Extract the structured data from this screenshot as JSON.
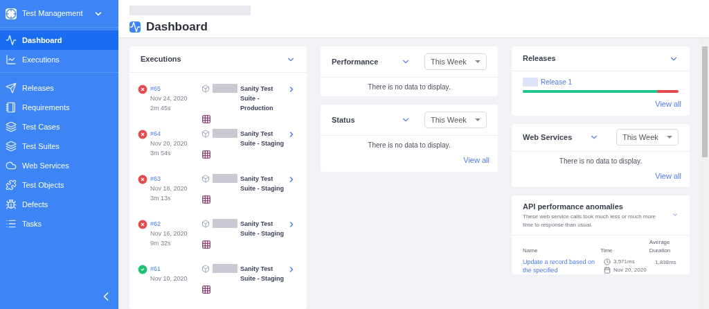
{
  "project": {
    "name": "Test Management"
  },
  "sidebar": {
    "sections": [
      {
        "items": [
          {
            "label": "Dashboard",
            "selected": true
          },
          {
            "label": "Executions",
            "selected": false
          }
        ]
      },
      {
        "items": [
          {
            "label": "Releases",
            "selected": false
          },
          {
            "label": "Requirements",
            "selected": false
          },
          {
            "label": "Test Cases",
            "selected": false
          },
          {
            "label": "Test Suites",
            "selected": false
          },
          {
            "label": "Web Services",
            "selected": false
          },
          {
            "label": "Test Objects",
            "selected": false
          },
          {
            "label": "Defects",
            "selected": false
          },
          {
            "label": "Tasks",
            "selected": false
          }
        ]
      }
    ]
  },
  "page": {
    "title": "Dashboard"
  },
  "executions": {
    "title": "Executions",
    "items": [
      {
        "passed": false,
        "id": "#65",
        "date": "Nov 24, 2020",
        "duration": "2m 45s",
        "name": "Sanity Test Suite - Production"
      },
      {
        "passed": false,
        "id": "#64",
        "date": "Nov 20, 2020",
        "duration": "3m 54s",
        "name": "Sanity Test Suite - Staging"
      },
      {
        "passed": false,
        "id": "#63",
        "date": "Nov 18, 2020",
        "duration": "3m 13s",
        "name": "Sanity Test Suite - Staging"
      },
      {
        "passed": false,
        "id": "#62",
        "date": "Nov 16, 2020",
        "duration": "9m 32s",
        "name": "Sanity Test Suite - Staging"
      },
      {
        "passed": true,
        "id": "#61",
        "date": "Nov 10, 2020",
        "name": "Sanity Test Suite - Staging"
      }
    ]
  },
  "performance": {
    "title": "Performance",
    "period": "This Week",
    "message": "There is no data to display."
  },
  "status": {
    "title": "Status",
    "period": "This Week",
    "message": "There is no data to display.",
    "link": "View all"
  },
  "releases": {
    "title": "Releases",
    "items": [
      {
        "name": "Release 1",
        "level": 0.86
      }
    ],
    "link": "View all"
  },
  "web_services": {
    "title": "Web Services",
    "period": "This Week",
    "message": "There is no data to display.",
    "link": "View all"
  },
  "api_anomalies": {
    "title": "API performance anomalies",
    "subtitle": "These web service calls took much less or much more time to response than usual.",
    "columns": [
      "Name",
      "Time",
      "Average Duration"
    ],
    "rows": [
      {
        "name": "Update a record based on the specified",
        "time": "3,571ms",
        "date": "Nov 20, 2020",
        "average": "1,838ms"
      }
    ]
  }
}
